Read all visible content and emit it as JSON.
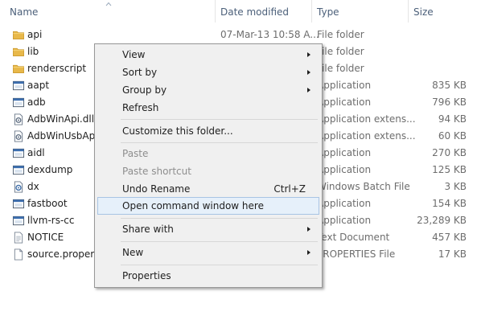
{
  "columns": {
    "name": "Name",
    "date_modified": "Date modified",
    "type": "Type",
    "size": "Size"
  },
  "files": [
    {
      "name": "api",
      "date": "07-Mar-13 10:58 A...",
      "type": "File folder",
      "size": "",
      "icon": "folder-icon"
    },
    {
      "name": "lib",
      "date": "",
      "type": "File folder",
      "size": "",
      "icon": "folder-icon"
    },
    {
      "name": "renderscript",
      "date": "",
      "type": "File folder",
      "size": "",
      "icon": "folder-icon"
    },
    {
      "name": "aapt",
      "date": "",
      "type": "Application",
      "size": "835 KB",
      "icon": "application-icon"
    },
    {
      "name": "adb",
      "date": "",
      "type": "Application",
      "size": "796 KB",
      "icon": "application-icon"
    },
    {
      "name": "AdbWinApi.dll",
      "date": "",
      "type": "Application extens...",
      "size": "94 KB",
      "icon": "dll-icon"
    },
    {
      "name": "AdbWinUsbApi.",
      "date": "",
      "type": "Application extens...",
      "size": "60 KB",
      "icon": "dll-icon"
    },
    {
      "name": "aidl",
      "date": "",
      "type": "Application",
      "size": "270 KB",
      "icon": "application-icon"
    },
    {
      "name": "dexdump",
      "date": "",
      "type": "Application",
      "size": "125 KB",
      "icon": "application-icon"
    },
    {
      "name": "dx",
      "date": "",
      "type": "Windows Batch File",
      "size": "3 KB",
      "icon": "batch-file-icon"
    },
    {
      "name": "fastboot",
      "date": "",
      "type": "Application",
      "size": "154 KB",
      "icon": "application-icon"
    },
    {
      "name": "llvm-rs-cc",
      "date": "",
      "type": "Application",
      "size": "23,289 KB",
      "icon": "application-icon"
    },
    {
      "name": "NOTICE",
      "date": "",
      "type": "Text Document",
      "size": "457 KB",
      "icon": "text-document-icon"
    },
    {
      "name": "source.properties",
      "date": "",
      "type": "PROPERTIES File",
      "size": "17 KB",
      "icon": "document-icon"
    }
  ],
  "context_menu": {
    "view": "View",
    "sort_by": "Sort by",
    "group_by": "Group by",
    "refresh": "Refresh",
    "customize": "Customize this folder...",
    "paste": "Paste",
    "paste_shortcut": "Paste shortcut",
    "undo_rename": "Undo Rename",
    "undo_shortcut": "Ctrl+Z",
    "open_cmd": "Open command window here",
    "share_with": "Share with",
    "new": "New",
    "properties": "Properties"
  },
  "colors": {
    "header_text": "#4c607a",
    "menu_background": "#f0f0f0",
    "highlight_background": "#e6f0fa",
    "highlight_border": "#a8c4e4",
    "folder_yellow": "#e8b84a"
  }
}
